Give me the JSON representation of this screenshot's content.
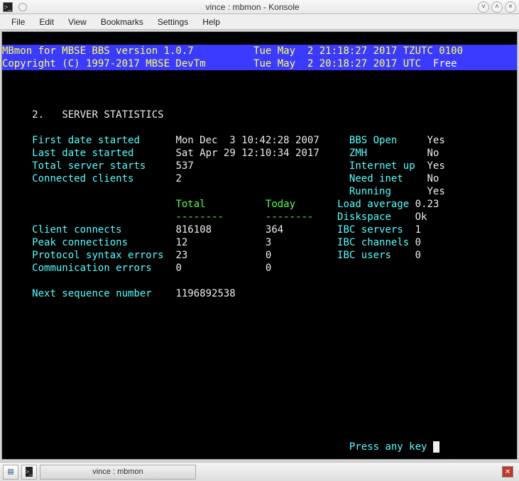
{
  "window": {
    "title": "vince : mbmon - Konsole"
  },
  "menu": {
    "file": "File",
    "edit": "Edit",
    "view": "View",
    "bookmarks": "Bookmarks",
    "settings": "Settings",
    "help": "Help"
  },
  "header": {
    "line1_left": "MBmon for MBSE BBS version 1.0.7",
    "line1_right": "Tue May  2 21:18:27 2017 TZUTC 0100",
    "line2_left": "Copyright (C) 1997-2017 MBSE DevTm",
    "line2_right_ts": "Tue May  2 20:18:27 2017 UTC  ",
    "line2_free": "Free"
  },
  "section": {
    "num": "2.",
    "title": "SERVER STATISTICS"
  },
  "labels": {
    "first_date": "First date started",
    "last_date": "Last date started",
    "total_starts": "Total server starts",
    "connected": "Connected clients",
    "total": "Total",
    "today": "Today",
    "sep": "--------",
    "client_connects": "Client connects",
    "peak_conn": "Peak connections",
    "proto_err": "Protocol syntax errors",
    "comm_err": "Communication errors",
    "next_seq": "Next sequence number",
    "bbs_open": "BBS Open",
    "zmh": "ZMH",
    "internet": "Internet up",
    "need_inet": "Need inet",
    "running": "Running",
    "load_avg": "Load average",
    "diskspace": "Diskspace",
    "ibc_srv": "IBC servers",
    "ibc_chan": "IBC channels",
    "ibc_usr": "IBC users",
    "press": "Press any key "
  },
  "values": {
    "first_date": "Mon Dec  3 10:42:28 2007",
    "last_date": "Sat Apr 29 12:10:34 2017",
    "total_starts": "537",
    "connected": "2",
    "client_connects_total": "816108",
    "client_connects_today": "364",
    "peak_total": "12",
    "peak_today": "3",
    "proto_total": "23",
    "proto_today": "0",
    "comm_total": "0",
    "comm_today": "0",
    "next_seq": "1196892538",
    "bbs_open": "Yes",
    "zmh": "No",
    "internet": "Yes",
    "need_inet": "No",
    "running": "Yes",
    "load_avg": "0.23",
    "diskspace": "Ok",
    "ibc_srv": "1",
    "ibc_chan": "0",
    "ibc_usr": "0"
  },
  "taskbar": {
    "active": "vince : mbmon"
  }
}
